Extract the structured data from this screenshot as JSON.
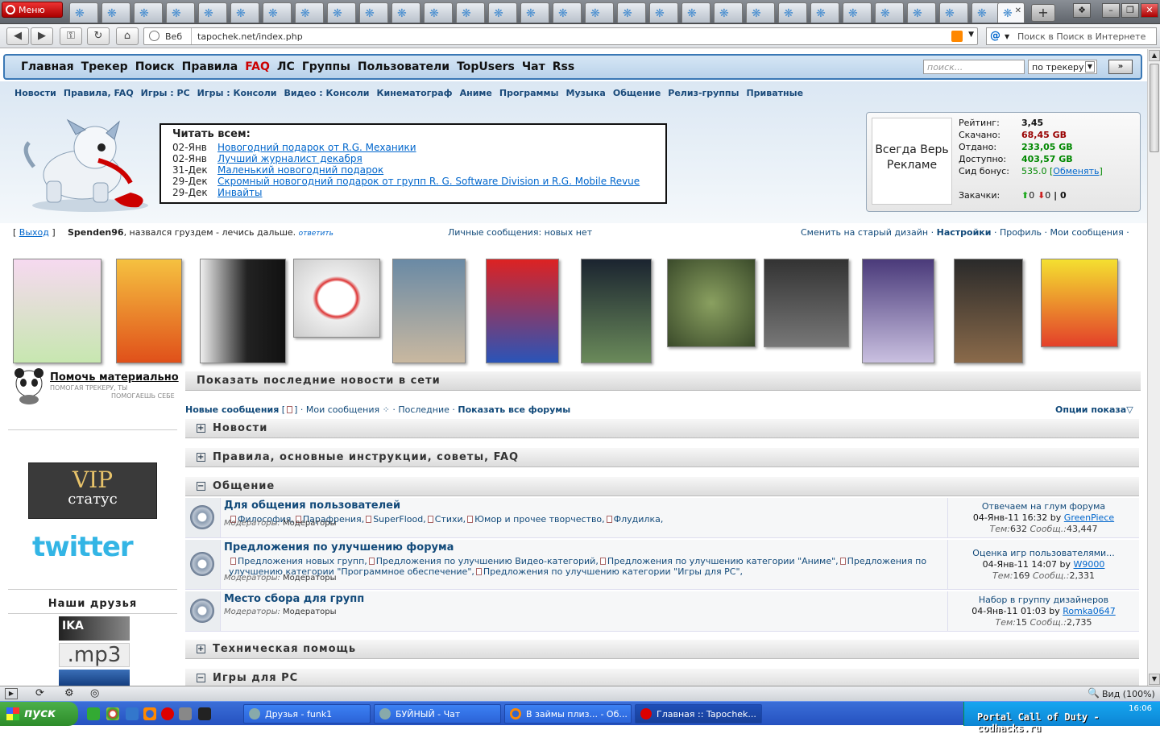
{
  "browser": {
    "menu_label": "Меню",
    "url_web": "Веб",
    "url": "tapochek.net/index.php",
    "search_placeholder": "Поиск в Поиск в Интернете",
    "status_zoom": "Вид (100%)"
  },
  "site_nav": {
    "links": [
      "Главная",
      "Трекер",
      "Поиск",
      "Правила",
      "FAQ",
      "ЛС",
      "Группы",
      "Пользователи",
      "TopUsers",
      "Чат",
      "Rss"
    ],
    "search_placeholder": "поиск...",
    "search_scope": "по трекеру",
    "go_label": "»"
  },
  "categories_nav": [
    "Новости",
    "Правила, FAQ",
    "Игры : PC",
    "Игры : Консоли",
    "Видео : Консоли",
    "Кинематограф",
    "Аниме",
    "Программы",
    "Музыка",
    "Общение",
    "Релиз-группы",
    "Приватные"
  ],
  "notice": {
    "title": "Читать всем:",
    "items": [
      {
        "date": "02-Янв",
        "text": "Новогодний подарок от R.G. Механики"
      },
      {
        "date": "02-Янв",
        "text": "Лучший журналист декабря"
      },
      {
        "date": "31-Дек",
        "text": "Маленький новогодний подарок"
      },
      {
        "date": "29-Дек",
        "text": "Скромный новогодний подарок от групп R. G. Software Division и R.G. Mobile Revue"
      },
      {
        "date": "29-Дек",
        "text": "Инвайты"
      }
    ]
  },
  "userbox": {
    "ad": "Всегда Верь Рекламе",
    "rating_label": "Рейтинг:",
    "rating": "3,45",
    "down_label": "Скачано:",
    "down": "68,45 GB",
    "up_label": "Отдано:",
    "up": "233,05 GB",
    "avail_label": "Доступно:",
    "avail": "403,57 GB",
    "bonus_label": "Сид бонус:",
    "bonus": "535.0",
    "bonus_link": "Обменять",
    "dl_label": "Закачки:",
    "dl_up": "0",
    "dl_down": "0",
    "dl_total": "0"
  },
  "userstrip": {
    "logout": "Выход",
    "username": "Spenden96",
    "greeting": ", назвался груздем - лечись дальше.",
    "reply": "ответить",
    "pm": "Личные сообщения: новых нет",
    "links": [
      "Сменить на старый дизайн",
      "Настройки",
      "Профиль",
      "Мои сообщения"
    ]
  },
  "sidebar": {
    "help_title": "Помочь материально",
    "help_sub1": "ПОМОГАЯ ТРЕКЕРУ, ТЫ",
    "help_sub2": "ПОМОГАЕШЬ СЕБЕ",
    "vip_a": "VIP",
    "vip_b": "статус",
    "twitter": "twitter",
    "friends_title": "Наши друзья",
    "friend1": "IKA",
    "friend2": ".mp3"
  },
  "main": {
    "news_bar": "Показать последние новости в сети",
    "links": {
      "new_posts": "Новые сообщения",
      "my_posts": "Мои сообщения",
      "recent": "Последние",
      "all": "Показать все форумы"
    },
    "options": "Опции показа",
    "cats": [
      "Новости",
      "Правила, основные инструкции, советы, FAQ",
      "Общение",
      "Техническая помощь",
      "Игры для PC"
    ],
    "forums": [
      {
        "title": "Для общения пользователей",
        "subs": [
          "Философия",
          "Парафрения",
          "SuperFlood",
          "Стихи",
          "Юмор и прочее творчество",
          "Флудилка"
        ],
        "mod_label": "Модераторы:",
        "mods": "Модераторы",
        "last_title": "Отвечаем на глум форума",
        "last_date": "04-Янв-11 16:32",
        "last_by": "GreenPiece",
        "topics": "632",
        "posts": "43,447"
      },
      {
        "title": "Предложения по улучшению форума",
        "subs": [
          "Предложения новых групп",
          "Предложения по улучшению Видео-категорий",
          "Предложения по улучшению категории \"Аниме\"",
          "Предложения по улучшению категории \"Программное обеспечение\"",
          "Предложения по улучшению категории \"Игры для PC\""
        ],
        "mod_label": "Модераторы:",
        "mods": "Модераторы",
        "last_title": "Оценка игр пользователями...",
        "last_date": "04-Янв-11 14:07",
        "last_by": "W9000",
        "topics": "169",
        "posts": "2,331"
      },
      {
        "title": "Место сбора для групп",
        "subs": [],
        "mod_label": "Модераторы:",
        "mods": "Модераторы",
        "last_title": "Набор в группу дизайнеров",
        "last_date": "04-Янв-11 01:03",
        "last_by": "Romka0647",
        "topics": "15",
        "posts": "2,735"
      }
    ],
    "topics_label": "Тем:",
    "posts_label": "Сообщ.:",
    "by_label": "by"
  },
  "taskbar": {
    "start": "пуск",
    "tasks": [
      "Друзья - funk1",
      "БУЙНЫЙ - Чат",
      "В займы плиз... - Об...",
      "Главная :: Tapochek..."
    ],
    "tray_text": "Portal Call of Duty - codhacks.ru",
    "clock": "16:06"
  }
}
